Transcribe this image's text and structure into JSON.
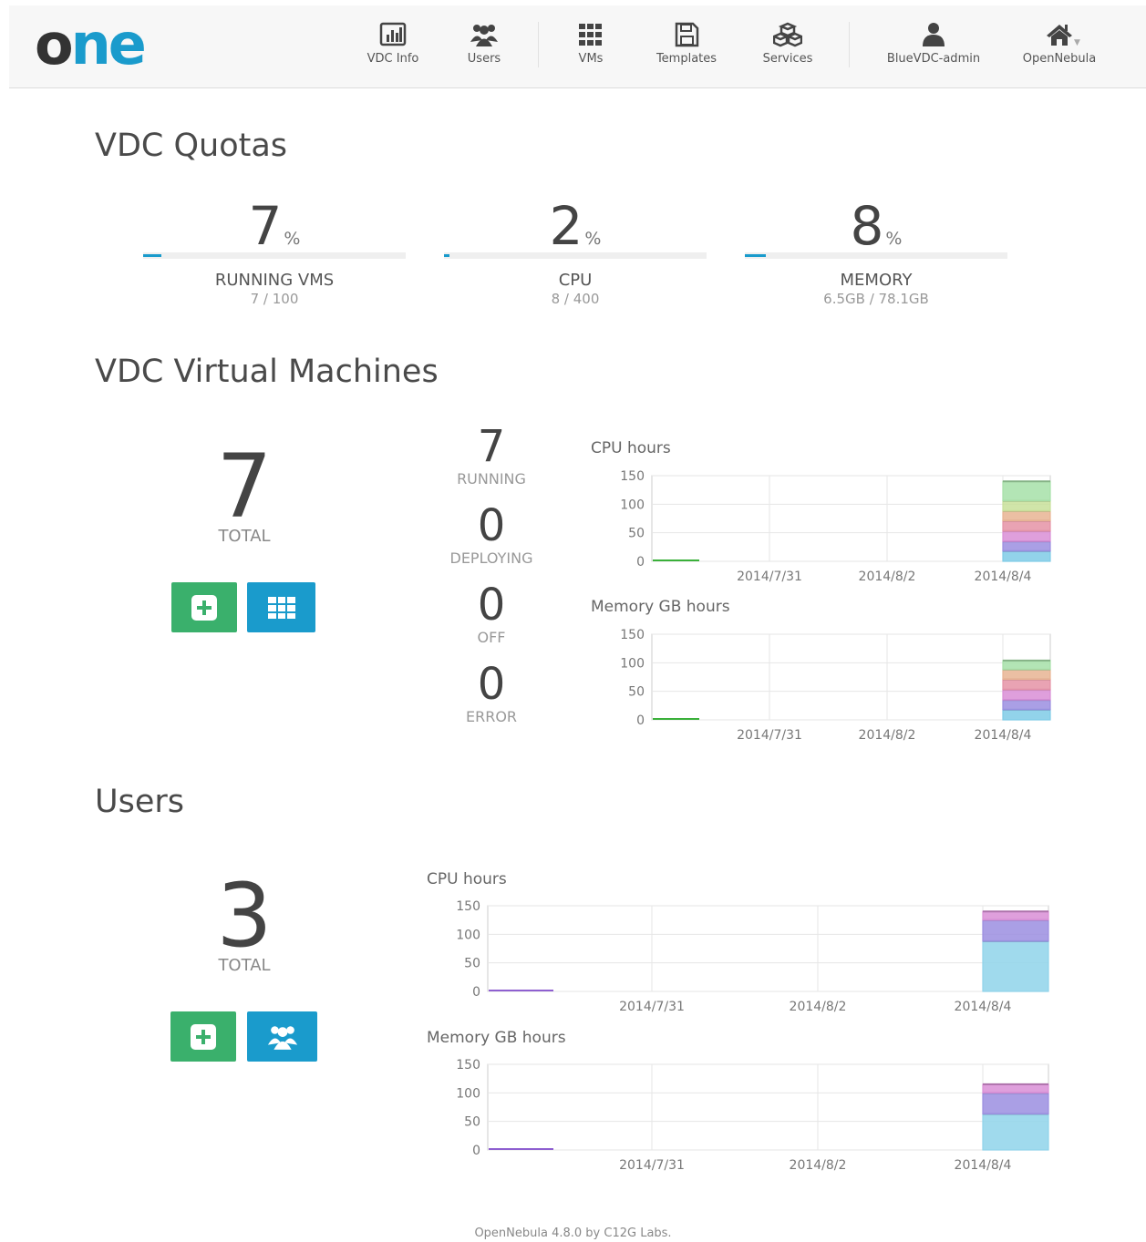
{
  "header": {
    "logo_o": "o",
    "logo_ne": "ne",
    "nav": [
      {
        "label": "VDC Info",
        "icon": "bar-chart-icon"
      },
      {
        "label": "Users",
        "icon": "users-icon"
      },
      {
        "label": "VMs",
        "icon": "grid-icon"
      },
      {
        "label": "Templates",
        "icon": "save-icon"
      },
      {
        "label": "Services",
        "icon": "cubes-icon"
      },
      {
        "label": "BlueVDC-admin",
        "icon": "user-icon"
      },
      {
        "label": "OpenNebula",
        "icon": "home-icon"
      }
    ]
  },
  "quotas": {
    "title": "VDC Quotas",
    "percent_sign": "%",
    "items": [
      {
        "value": "7",
        "name": "RUNNING VMS",
        "sub": "7 / 100",
        "fraction": 0.07
      },
      {
        "value": "2",
        "name": "CPU",
        "sub": "8 / 400",
        "fraction": 0.02
      },
      {
        "value": "8",
        "name": "MEMORY",
        "sub": "6.5GB / 78.1GB",
        "fraction": 0.08
      }
    ]
  },
  "vms": {
    "title": "VDC Virtual Machines",
    "total": "7",
    "total_label": "TOTAL",
    "states": [
      {
        "value": "7",
        "label": "RUNNING"
      },
      {
        "value": "0",
        "label": "DEPLOYING"
      },
      {
        "value": "0",
        "label": "OFF"
      },
      {
        "value": "0",
        "label": "ERROR"
      }
    ]
  },
  "users": {
    "title": "Users",
    "total": "3",
    "total_label": "TOTAL"
  },
  "footer": "OpenNebula 4.8.0 by C12G Labs.",
  "colors": {
    "accent": "#1a9bcc",
    "green_button": "#3ab06c"
  },
  "chart_data": [
    {
      "id": "vm_cpu",
      "type": "bar",
      "stacked": true,
      "title": "CPU hours",
      "x_ticks": [
        "2014/7/31",
        "2014/8/2",
        "2014/8/4"
      ],
      "ylim": [
        0,
        150
      ],
      "y_ticks": [
        0,
        50,
        100,
        150
      ],
      "grid": true,
      "segments_at_2014_8_4": [
        18,
        17,
        18,
        18,
        17,
        18,
        34
      ],
      "segment_colors": [
        "#7fcbe6",
        "#9b8ee0",
        "#d98ed6",
        "#e593a6",
        "#e8b493",
        "#c8e09a",
        "#a6e0a8"
      ],
      "baseline_line": {
        "x_range": [
          "2014/7/29",
          "2014/7/30"
        ],
        "value": 0,
        "color": "#3ab03a"
      }
    },
    {
      "id": "vm_mem",
      "type": "bar",
      "stacked": true,
      "title": "Memory GB hours",
      "x_ticks": [
        "2014/7/31",
        "2014/8/2",
        "2014/8/4"
      ],
      "ylim": [
        0,
        150
      ],
      "y_ticks": [
        0,
        50,
        100,
        150
      ],
      "grid": true,
      "segments_at_2014_8_4": [
        18,
        17,
        18,
        18,
        17,
        16
      ],
      "segment_colors": [
        "#7fcbe6",
        "#9b8ee0",
        "#d98ed6",
        "#e593a6",
        "#e8b493",
        "#a6e0a8"
      ],
      "baseline_line": {
        "x_range": [
          "2014/7/29",
          "2014/7/30"
        ],
        "value": 0,
        "color": "#3ab03a"
      }
    },
    {
      "id": "user_cpu",
      "type": "bar",
      "stacked": true,
      "title": "CPU hours",
      "x_ticks": [
        "2014/7/31",
        "2014/8/2",
        "2014/8/4"
      ],
      "ylim": [
        0,
        150
      ],
      "y_ticks": [
        0,
        50,
        100,
        150
      ],
      "grid": true,
      "segments_at_2014_8_4": [
        88,
        37,
        15
      ],
      "segment_colors": [
        "#8fd3ea",
        "#9b8ee0",
        "#d98ed6"
      ],
      "baseline_line": {
        "x_range": [
          "2014/7/29",
          "2014/7/30"
        ],
        "value": 0,
        "color": "#8e5fd0"
      }
    },
    {
      "id": "user_mem",
      "type": "bar",
      "stacked": true,
      "title": "Memory GB hours",
      "x_ticks": [
        "2014/7/31",
        "2014/8/2",
        "2014/8/4"
      ],
      "ylim": [
        0,
        150
      ],
      "y_ticks": [
        0,
        50,
        100,
        150
      ],
      "grid": true,
      "segments_at_2014_8_4": [
        63,
        37,
        15
      ],
      "segment_colors": [
        "#8fd3ea",
        "#9b8ee0",
        "#d98ed6"
      ],
      "baseline_line": {
        "x_range": [
          "2014/7/29",
          "2014/7/30"
        ],
        "value": 0,
        "color": "#8e5fd0"
      }
    }
  ]
}
